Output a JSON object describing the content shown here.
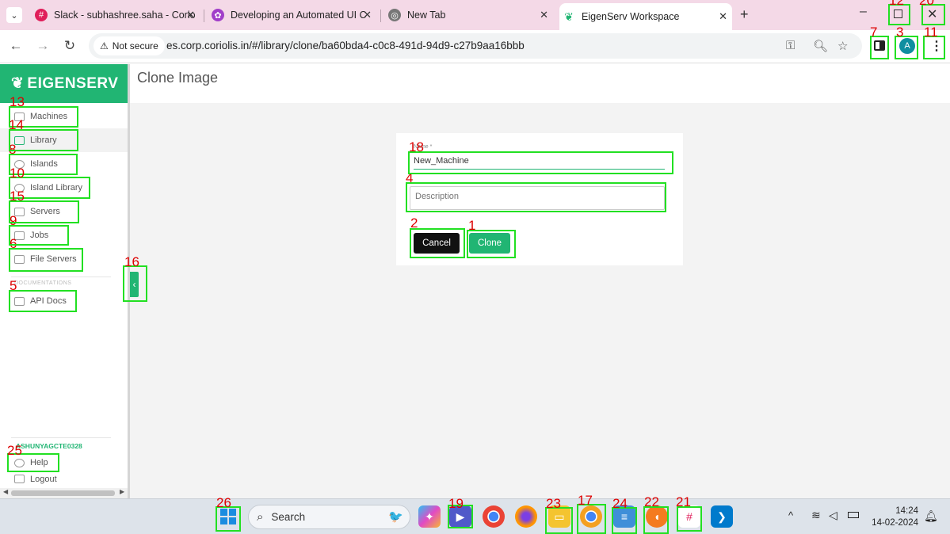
{
  "browser": {
    "tabs": [
      {
        "label": "Slack - subhashree.saha - Corio"
      },
      {
        "label": "Developing an Automated UI C"
      },
      {
        "label": "New Tab"
      },
      {
        "label": "EigenServ Workspace"
      }
    ],
    "not_secure_label": "Not secure",
    "url": "es.corp.coriolis.in/#/library/clone/ba60bda4-c0c8-491d-94d9-c27b9aa16bbb",
    "profile_initial": "A"
  },
  "sidebar": {
    "brand": "EIGENSERV",
    "items": [
      {
        "label": "Machines"
      },
      {
        "label": "Library"
      },
      {
        "label": "Islands"
      },
      {
        "label": "Island Library"
      },
      {
        "label": "Servers"
      },
      {
        "label": "Jobs"
      },
      {
        "label": "File Servers"
      }
    ],
    "section_label": "DOCUMENTATIONS",
    "doc_items": [
      {
        "label": "API Docs"
      }
    ],
    "user": "ASHUNYAGCTE0328",
    "help_label": "Help",
    "logout_label": "Logout"
  },
  "main": {
    "title": "Clone Image",
    "form": {
      "name_label": "Name *",
      "name_value": "New_Machine",
      "description_placeholder": "Description",
      "cancel_label": "Cancel",
      "clone_label": "Clone"
    }
  },
  "taskbar": {
    "search_placeholder": "Search",
    "time": "14:24",
    "date": "14-02-2024"
  },
  "markers": [
    "1",
    "2",
    "3",
    "4",
    "5",
    "6",
    "7",
    "8",
    "9",
    "10",
    "11",
    "12",
    "13",
    "14",
    "15",
    "16",
    "17",
    "18",
    "19",
    "20",
    "21",
    "22",
    "23",
    "24",
    "25",
    "26"
  ],
  "colors": {
    "brand": "#21b573",
    "tabstrip": "#f4d9e7",
    "highlight": "#22e022",
    "marker": "#dd0000"
  }
}
